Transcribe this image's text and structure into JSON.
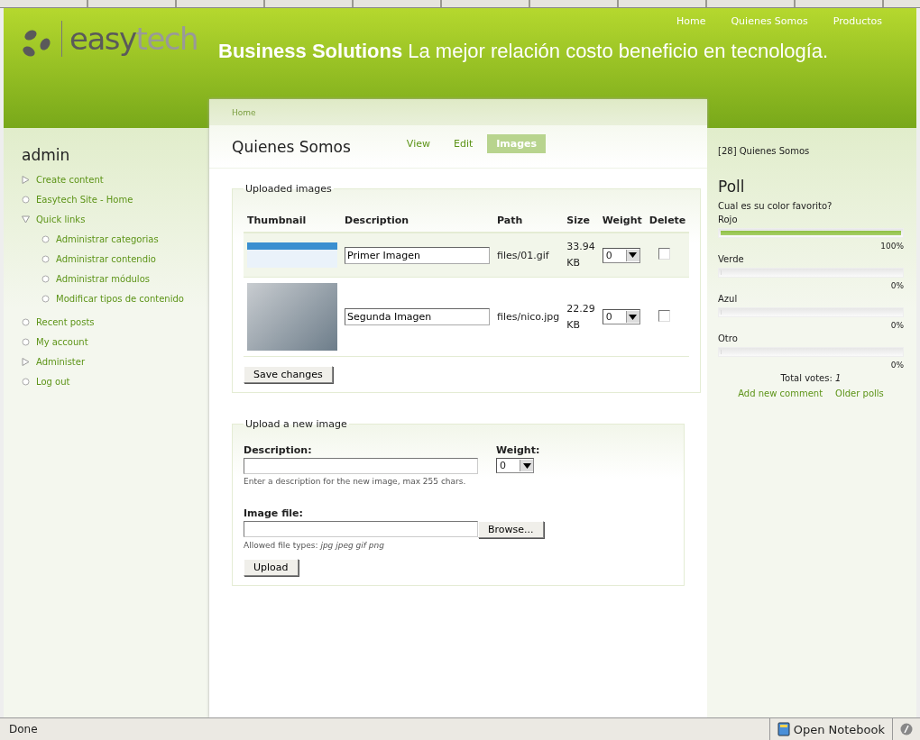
{
  "logo": {
    "part_1": "easy",
    "part_2": "tech"
  },
  "primary_links": [
    {
      "label": "Home"
    },
    {
      "label": "Quienes Somos"
    },
    {
      "label": "Productos"
    }
  ],
  "slogan": "**Business Solutions** La mejor relación costo beneficio en tecnología.",
  "sidebar": {
    "title": "admin",
    "items": [
      {
        "label": "Create content",
        "kind": "collapsed"
      },
      {
        "label": "Easytech Site - Home",
        "kind": "leaf"
      },
      {
        "label": "Quick links",
        "kind": "expanded",
        "children": [
          {
            "label": "Administrar categorias",
            "kind": "leaf"
          },
          {
            "label": "Administrar contendio",
            "kind": "leaf"
          },
          {
            "label": "Administrar módulos",
            "kind": "leaf"
          },
          {
            "label": "Modificar tipos de contenido",
            "kind": "leaf"
          }
        ]
      },
      {
        "label": "Recent posts",
        "kind": "leaf"
      },
      {
        "label": "My account",
        "kind": "leaf"
      },
      {
        "label": "Administer",
        "kind": "collapsed"
      },
      {
        "label": "Log out",
        "kind": "leaf"
      }
    ]
  },
  "breadcrumb": "Home",
  "page_title": "Quienes Somos",
  "tabs": [
    {
      "label": "View",
      "selected": false
    },
    {
      "label": "Edit",
      "selected": false
    },
    {
      "label": "Images",
      "selected": true
    }
  ],
  "uploaded": {
    "legend": "Uploaded images",
    "columns": [
      "Thumbnail",
      "Description",
      "Path",
      "Size",
      "Weight",
      "Delete"
    ],
    "rows": [
      {
        "kind": "screenshot",
        "description": "Primer Imagen",
        "path": "files/01.gif",
        "size": "33.94 KB",
        "weight": "0",
        "delete": false
      },
      {
        "kind": "photo",
        "description": "Segunda Imagen",
        "path": "files/nico.jpg",
        "size": "22.29 KB",
        "weight": "0",
        "delete": false
      }
    ],
    "button": "Save changes"
  },
  "upload": {
    "legend": "Upload a new image",
    "description_label": "Description:",
    "description_help": "Enter a description for the new image, max 255 chars.",
    "weight_label": "Weight:",
    "weight": "0",
    "file_label": "Image file:",
    "browse": "Browse...",
    "file_help": "Allowed file types: *jpg jpeg gif png*",
    "button": "Upload"
  },
  "right": {
    "node_link": "[28] Quienes Somos",
    "poll_title": "Poll",
    "question": "Cual es su color favorito?",
    "choices": [
      {
        "label": "Rojo",
        "level": 1,
        "percent": "100%"
      },
      {
        "label": "Verde",
        "level": 0,
        "percent": "0%"
      },
      {
        "label": "Azul",
        "level": 0,
        "percent": "0%"
      },
      {
        "label": "Otro",
        "level": 0,
        "percent": "0%"
      }
    ],
    "total": "Total votes: *1*",
    "links": [
      "Add new comment",
      "Older polls"
    ]
  },
  "status_bar": {
    "text": "Done",
    "notebook": "Open Notebook"
  }
}
